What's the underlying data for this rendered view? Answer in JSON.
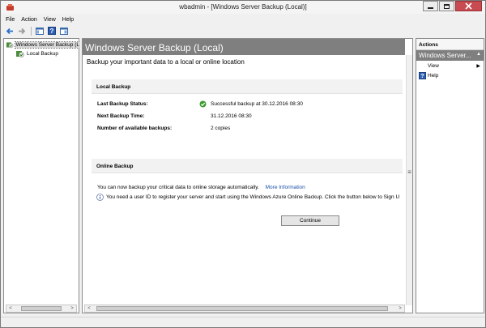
{
  "window": {
    "title": "wbadmin - [Windows Server Backup (Local)]"
  },
  "menu": [
    "File",
    "Action",
    "View",
    "Help"
  ],
  "toolbar": {
    "icons": [
      "back-arrow-icon",
      "forward-arrow-icon",
      "show-hide-console-tree-icon",
      "help-icon",
      "properties-icon"
    ]
  },
  "tree": {
    "items": [
      {
        "label": "Windows Server Backup (L",
        "selected": true
      },
      {
        "label": "Local Backup",
        "selected": false
      }
    ]
  },
  "center": {
    "header": "Windows Server Backup (Local)",
    "subtitle": "Backup your important data to a local or online location",
    "local_backup": {
      "title": "Local Backup",
      "rows": [
        {
          "label": "Last Backup Status:",
          "value": "Successful backup at 30.12.2016 08:30"
        },
        {
          "label": "Next Backup Time:",
          "value": "31.12.2016 08:30"
        },
        {
          "label": "Number of available backups:",
          "value": "2 copies"
        }
      ]
    },
    "online_backup": {
      "title": "Online Backup",
      "text1": "You can now backup your critical data to online storage automatically.",
      "link": "More Information",
      "text2": "You need a user ID to register your server and start using the Windows Azure Online Backup. Click the button below to Sign U",
      "button": "Continue"
    }
  },
  "actions": {
    "title": "Actions",
    "group": "Windows Server...",
    "items": [
      "View",
      "Help"
    ]
  },
  "colors": {
    "header_gray": "#7f7f7f",
    "link_blue": "#1a4fa8",
    "close_red": "#c74b50",
    "success_green": "#3a9a2c"
  }
}
